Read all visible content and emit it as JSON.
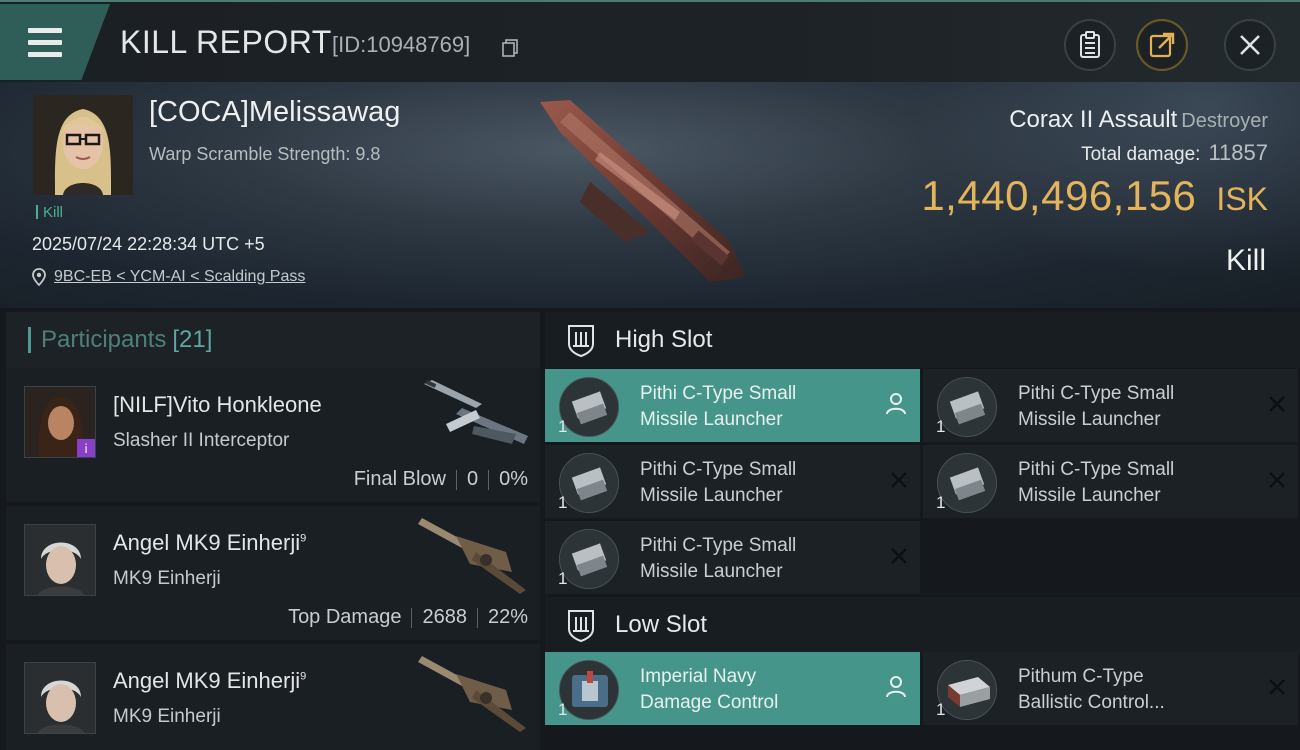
{
  "header": {
    "title": "KILL REPORT",
    "report_id": "[ID:10948769]"
  },
  "victim": {
    "name": "[COCA]Melissawag",
    "warp_scramble": "Warp Scramble Strength: 9.8",
    "kill_tag": "Kill",
    "timestamp": "2025/07/24 22:28:34 UTC +5",
    "location": "9BC-EB < YCM-AI < Scalding Pass",
    "ship_name": "Corax II Assault",
    "ship_class": "Destroyer",
    "total_damage_label": "Total damage:",
    "total_damage_value": "11857",
    "isk_value": "1,440,496,156",
    "isk_unit": "ISK",
    "result_label": "Kill"
  },
  "participants": {
    "label": "Participants",
    "count": "[21]",
    "rows": [
      {
        "name": "[NILF]Vito Honkleone",
        "sup": "",
        "ship": "Slasher II Interceptor",
        "role": "Final Blow",
        "damage": "0",
        "percent": "0%"
      },
      {
        "name": "Angel MK9 Einherji",
        "sup": "9",
        "ship": "MK9 Einherji",
        "role": "Top Damage",
        "damage": "2688",
        "percent": "22%"
      },
      {
        "name": "Angel MK9 Einherji",
        "sup": "9",
        "ship": "MK9 Einherji",
        "role": "",
        "damage": "",
        "percent": ""
      }
    ]
  },
  "slots": {
    "high_label": "High Slot",
    "low_label": "Low Slot",
    "high_modules": [
      {
        "line1": "Pithi C-Type Small",
        "line2": "Missile Launcher",
        "qty": "1",
        "state": "fitted-pilot"
      },
      {
        "line1": "Pithi C-Type Small",
        "line2": "Missile Launcher",
        "qty": "1",
        "state": "destroyed"
      },
      {
        "line1": "Pithi C-Type Small",
        "line2": "Missile Launcher",
        "qty": "1",
        "state": "destroyed"
      },
      {
        "line1": "Pithi C-Type Small",
        "line2": "Missile Launcher",
        "qty": "1",
        "state": "destroyed"
      },
      {
        "line1": "Pithi C-Type Small",
        "line2": "Missile Launcher",
        "qty": "1",
        "state": "destroyed"
      }
    ],
    "low_modules": [
      {
        "line1": "Imperial Navy",
        "line2": "Damage Control",
        "qty": "1",
        "state": "fitted-pilot"
      },
      {
        "line1": "Pithum C-Type",
        "line2": "Ballistic Control...",
        "qty": "1",
        "state": "destroyed"
      }
    ]
  },
  "colors": {
    "accent_teal": "#46958a",
    "isk_gold": "#e3b45c",
    "kill_green": "#4cae92"
  }
}
